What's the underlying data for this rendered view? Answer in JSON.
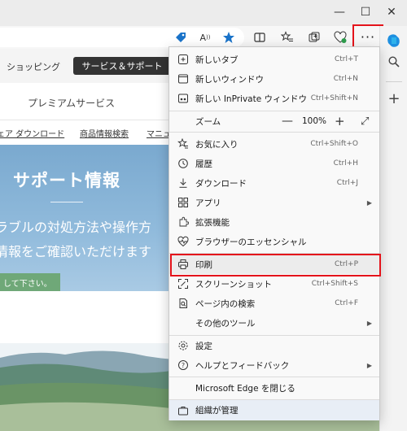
{
  "window": {
    "minimize": "—",
    "maximize": "☐",
    "close": "✕"
  },
  "toolbar": {
    "more_button": "···"
  },
  "page": {
    "nav_shopping": "ショッピング",
    "nav_support": "サービス＆サポート",
    "nav_premium": "プレミアムサービス",
    "links": [
      "ェア ダウンロード",
      "商品情報検索",
      "マニュ"
    ],
    "hero_title": "サポート情報",
    "hero_line1": "ラブルの対処方法や操作方",
    "hero_line2": "情報をご確認いただけます",
    "hero_button": "して下さい。"
  },
  "menu": {
    "new_tab": {
      "label": "新しいタブ",
      "shortcut": "Ctrl+T"
    },
    "new_window": {
      "label": "新しいウィンドウ",
      "shortcut": "Ctrl+N"
    },
    "new_inprivate": {
      "label": "新しい InPrivate ウィンドウ",
      "shortcut": "Ctrl+Shift+N"
    },
    "zoom": {
      "label": "ズーム",
      "minus": "—",
      "value": "100%",
      "plus": "+",
      "fullscreen": "⤢"
    },
    "favorites": {
      "label": "お気に入り",
      "shortcut": "Ctrl+Shift+O"
    },
    "history": {
      "label": "履歴",
      "shortcut": "Ctrl+H"
    },
    "downloads": {
      "label": "ダウンロード",
      "shortcut": "Ctrl+J"
    },
    "apps": {
      "label": "アプリ"
    },
    "extensions": {
      "label": "拡張機能"
    },
    "essentials": {
      "label": "ブラウザーのエッセンシャル"
    },
    "print": {
      "label": "印刷",
      "shortcut": "Ctrl+P"
    },
    "screenshot": {
      "label": "スクリーンショット",
      "shortcut": "Ctrl+Shift+S"
    },
    "find": {
      "label": "ページ内の検索",
      "shortcut": "Ctrl+F"
    },
    "more_tools": {
      "label": "その他のツール"
    },
    "settings": {
      "label": "設定"
    },
    "help": {
      "label": "ヘルプとフィードバック"
    },
    "close_edge": {
      "label": "Microsoft Edge を閉じる"
    },
    "managed": {
      "label": "組織が管理"
    }
  },
  "colors": {
    "highlight_border": "#e4131b",
    "edge_blue": "#0f6cbd"
  }
}
